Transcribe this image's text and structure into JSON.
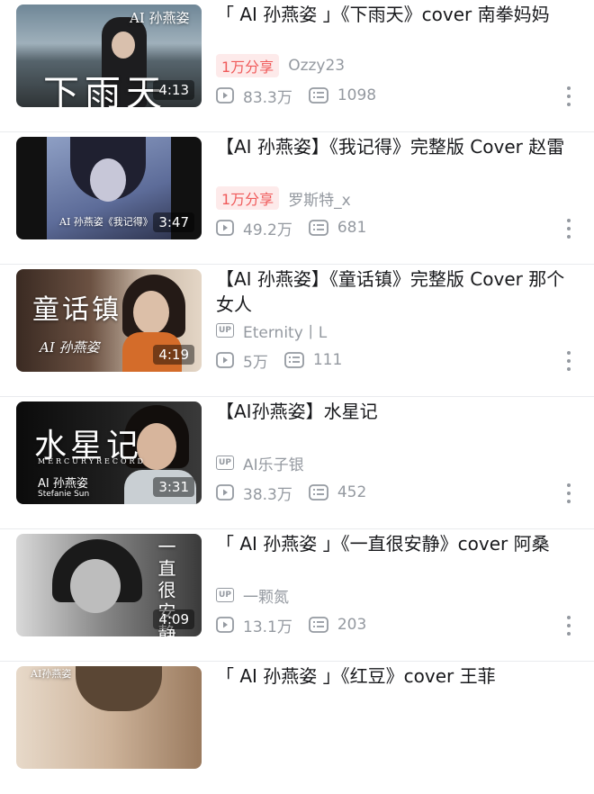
{
  "videos": [
    {
      "title": "「 AI  孙燕姿 」《下雨天》cover  南拳妈妈",
      "thumb_caption_top": "AI 孙燕姿",
      "thumb_caption_big": "下雨天",
      "duration": "4:13",
      "share_badge": "1万分享",
      "uploader": "Ozzy23",
      "views": "83.3万",
      "comments": "1098"
    },
    {
      "title": "【AI  孙燕姿】《我记得》完整版  Cover 赵雷",
      "thumb_caption_top": "AI 孙燕姿《我记得》",
      "thumb_caption_big": "",
      "duration": "3:47",
      "share_badge": "1万分享",
      "uploader": "罗斯特_x",
      "views": "49.2万",
      "comments": "681"
    },
    {
      "title": "【AI  孙燕姿】《童话镇》完整版  Cover 那个女人",
      "thumb_caption_top": "AI 孙燕姿",
      "thumb_caption_big": "童话镇",
      "duration": "4:19",
      "up_badge": "UP",
      "uploader": "Eternity丨L",
      "views": "5万",
      "comments": "111"
    },
    {
      "title": "【AI孙燕姿】水星记",
      "thumb_caption_top": "MERCURYRECORD",
      "thumb_caption_big": "水星记",
      "thumb_caption_sub": "AI 孙燕姿",
      "thumb_caption_sub2": "Stefanie  Sun",
      "duration": "3:31",
      "up_badge": "UP",
      "uploader": "AI乐子银",
      "views": "38.3万",
      "comments": "452"
    },
    {
      "title": "「 AI  孙燕姿 」《一直很安静》cover 阿桑",
      "thumb_caption_big": "一直很安静",
      "duration": "4:09",
      "up_badge": "UP",
      "uploader": "一颗氮",
      "views": "13.1万",
      "comments": "203"
    },
    {
      "title": "「 AI  孙燕姿 」《红豆》cover  王菲",
      "thumb_caption_top": "AI孙燕姿"
    }
  ],
  "icons": {
    "play": "play-count-icon",
    "comment": "comment-count-icon",
    "more": "more-options-icon"
  },
  "colors": {
    "accent": "#f05a5a",
    "meta_gray": "#9499a0",
    "title": "#18191c"
  }
}
